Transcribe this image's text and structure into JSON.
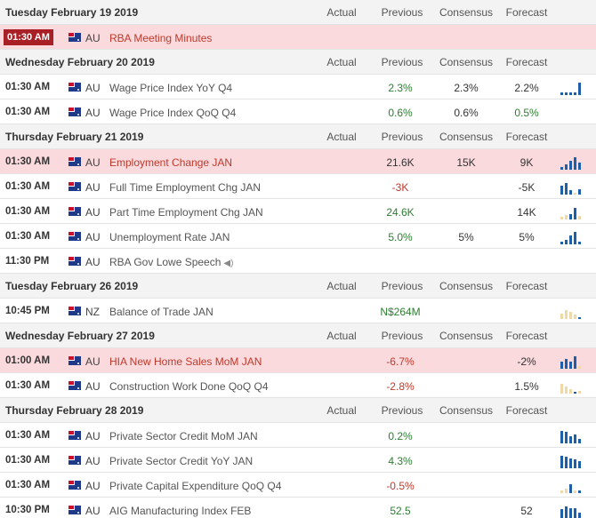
{
  "columns": {
    "actual": "Actual",
    "previous": "Previous",
    "consensus": "Consensus",
    "forecast": "Forecast"
  },
  "colors": {
    "blue": "#1f5fa8",
    "tan": "#f0d9a8",
    "green": "#2e7d32",
    "red": "#c0392b",
    "highlight": "#fadadd"
  },
  "sections": [
    {
      "date": "Tuesday February 19 2019",
      "events": [
        {
          "time": "01:30 AM",
          "country": "AU",
          "name": "RBA Meeting Minutes",
          "highlight": true,
          "badge": true,
          "previous": "",
          "consensus": "",
          "forecast": "",
          "prev_color": "",
          "fore_color": "",
          "spark": []
        }
      ]
    },
    {
      "date": "Wednesday February 20 2019",
      "events": [
        {
          "time": "01:30 AM",
          "country": "AU",
          "name": "Wage Price Index YoY Q4",
          "highlight": false,
          "previous": "2.3%",
          "consensus": "2.3%",
          "forecast": "2.2%",
          "prev_color": "green",
          "fore_color": "dark",
          "spark": [
            [
              "b",
              0.2
            ],
            [
              "b",
              0.2
            ],
            [
              "b",
              0.2
            ],
            [
              "b",
              0.2
            ],
            [
              "b",
              0.9
            ]
          ]
        },
        {
          "time": "01:30 AM",
          "country": "AU",
          "name": "Wage Price Index QoQ Q4",
          "highlight": false,
          "previous": "0.6%",
          "consensus": "0.6%",
          "forecast": "0.5%",
          "prev_color": "green",
          "fore_color": "green",
          "spark": []
        }
      ]
    },
    {
      "date": "Thursday February 21 2019",
      "events": [
        {
          "time": "01:30 AM",
          "country": "AU",
          "name": "Employment Change JAN",
          "highlight": true,
          "previous": "21.6K",
          "consensus": "15K",
          "forecast": "9K",
          "prev_color": "dark",
          "fore_color": "dark",
          "spark": [
            [
              "b",
              0.2
            ],
            [
              "b",
              0.4
            ],
            [
              "b",
              0.6
            ],
            [
              "b",
              0.9
            ],
            [
              "b",
              0.5
            ]
          ]
        },
        {
          "time": "01:30 AM",
          "country": "AU",
          "name": "Full Time Employment Chg JAN",
          "highlight": false,
          "previous": "-3K",
          "consensus": "",
          "forecast": "-5K",
          "prev_color": "red",
          "fore_color": "dark",
          "spark": [
            [
              "b",
              0.6
            ],
            [
              "b",
              0.8
            ],
            [
              "b",
              0.3
            ],
            [
              "t",
              0.15
            ],
            [
              "b",
              0.4
            ]
          ]
        },
        {
          "time": "01:30 AM",
          "country": "AU",
          "name": "Part Time Employment Chg JAN",
          "highlight": false,
          "previous": "24.6K",
          "consensus": "",
          "forecast": "14K",
          "prev_color": "green",
          "fore_color": "dark",
          "spark": [
            [
              "t",
              0.2
            ],
            [
              "t",
              0.3
            ],
            [
              "b",
              0.4
            ],
            [
              "b",
              0.8
            ],
            [
              "t",
              0.25
            ]
          ]
        },
        {
          "time": "01:30 AM",
          "country": "AU",
          "name": "Unemployment Rate JAN",
          "highlight": false,
          "previous": "5.0%",
          "consensus": "5%",
          "forecast": "5%",
          "prev_color": "green",
          "fore_color": "dark",
          "spark": [
            [
              "b",
              0.2
            ],
            [
              "b",
              0.3
            ],
            [
              "b",
              0.6
            ],
            [
              "b",
              0.9
            ],
            [
              "b",
              0.2
            ]
          ]
        },
        {
          "time": "11:30 PM",
          "country": "AU",
          "name": "RBA Gov Lowe Speech",
          "speaker": true,
          "highlight": false,
          "previous": "",
          "consensus": "",
          "forecast": "",
          "prev_color": "",
          "fore_color": "",
          "spark": []
        }
      ]
    },
    {
      "date": "Tuesday February 26 2019",
      "events": [
        {
          "time": "10:45 PM",
          "country": "NZ",
          "name": "Balance of Trade JAN",
          "highlight": false,
          "previous": "N$264M",
          "consensus": "",
          "forecast": "",
          "prev_color": "green",
          "fore_color": "",
          "spark": [
            [
              "t",
              0.4
            ],
            [
              "t",
              0.6
            ],
            [
              "t",
              0.5
            ],
            [
              "t",
              0.3
            ],
            [
              "b",
              0.1
            ]
          ]
        }
      ]
    },
    {
      "date": "Wednesday February 27 2019",
      "events": [
        {
          "time": "01:00 AM",
          "country": "AU",
          "name": "HIA New Home Sales MoM JAN",
          "highlight": true,
          "previous": "-6.7%",
          "consensus": "",
          "forecast": "-2%",
          "prev_color": "red",
          "fore_color": "dark",
          "spark": [
            [
              "b",
              0.5
            ],
            [
              "b",
              0.7
            ],
            [
              "b",
              0.5
            ],
            [
              "b",
              0.9
            ],
            [
              "t",
              0.2
            ]
          ]
        },
        {
          "time": "01:30 AM",
          "country": "AU",
          "name": "Construction Work Done QoQ Q4",
          "highlight": false,
          "previous": "-2.8%",
          "consensus": "",
          "forecast": "1.5%",
          "prev_color": "red",
          "fore_color": "dark",
          "spark": [
            [
              "t",
              0.7
            ],
            [
              "t",
              0.5
            ],
            [
              "t",
              0.3
            ],
            [
              "b",
              0.1
            ],
            [
              "t",
              0.2
            ]
          ]
        }
      ]
    },
    {
      "date": "Thursday February 28 2019",
      "events": [
        {
          "time": "01:30 AM",
          "country": "AU",
          "name": "Private Sector Credit MoM JAN",
          "highlight": false,
          "previous": "0.2%",
          "consensus": "",
          "forecast": "",
          "prev_color": "green",
          "fore_color": "",
          "spark": [
            [
              "b",
              0.9
            ],
            [
              "b",
              0.8
            ],
            [
              "b",
              0.5
            ],
            [
              "b",
              0.6
            ],
            [
              "b",
              0.3
            ]
          ]
        },
        {
          "time": "01:30 AM",
          "country": "AU",
          "name": "Private Sector Credit YoY JAN",
          "highlight": false,
          "previous": "4.3%",
          "consensus": "",
          "forecast": "",
          "prev_color": "green",
          "fore_color": "",
          "spark": [
            [
              "b",
              0.9
            ],
            [
              "b",
              0.8
            ],
            [
              "b",
              0.7
            ],
            [
              "b",
              0.6
            ],
            [
              "b",
              0.5
            ]
          ]
        },
        {
          "time": "01:30 AM",
          "country": "AU",
          "name": "Private Capital Expenditure QoQ Q4",
          "highlight": false,
          "previous": "-0.5%",
          "consensus": "",
          "forecast": "",
          "prev_color": "red",
          "fore_color": "",
          "spark": [
            [
              "t",
              0.2
            ],
            [
              "t",
              0.3
            ],
            [
              "b",
              0.6
            ],
            [
              "t",
              0.2
            ],
            [
              "b",
              0.2
            ]
          ]
        },
        {
          "time": "10:30 PM",
          "country": "AU",
          "name": "AIG Manufacturing Index FEB",
          "highlight": false,
          "previous": "52.5",
          "consensus": "",
          "forecast": "52",
          "prev_color": "green",
          "fore_color": "dark",
          "spark": [
            [
              "b",
              0.6
            ],
            [
              "b",
              0.8
            ],
            [
              "b",
              0.7
            ],
            [
              "b",
              0.7
            ],
            [
              "b",
              0.4
            ]
          ]
        }
      ]
    }
  ]
}
